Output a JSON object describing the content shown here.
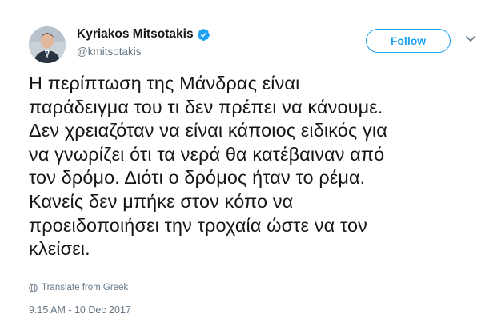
{
  "author": {
    "display_name": "Kyriakos Mitsotakis",
    "handle": "@kmitsotakis",
    "verified": true
  },
  "follow_button": {
    "label": "Follow"
  },
  "tweet": {
    "lines": [
      "Η περίπτωση της Μάνδρας είναι",
      "παράδειγμα του τι δεν πρέπει να κάνουμε.",
      "Δεν χρειαζόταν να είναι κάποιος ειδικός για",
      "να γνωρίζει ότι τα νερά θα κατέβαιναν από",
      "τον δρόμο. Διότι ο δρόμος ήταν το ρέμα.",
      "Κανείς δεν μπήκε στον κόπο να",
      "προειδοποιήσει την τροχαία ώστε να τον",
      "κλείσει."
    ],
    "translate_label": "Translate from Greek",
    "timestamp": "9:15 AM - 10 Dec 2017"
  },
  "colors": {
    "accent": "#1da1f2",
    "text_primary": "#14171a",
    "text_secondary": "#657786",
    "divider": "#e6ecf0"
  },
  "icons": {
    "verified": "verified-badge-icon",
    "menu": "chevron-down-icon",
    "translate": "globe-icon"
  }
}
